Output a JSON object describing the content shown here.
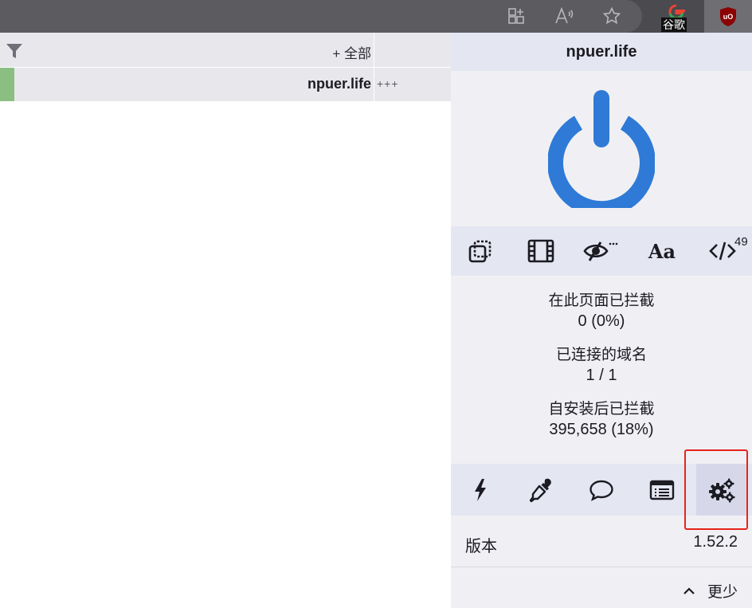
{
  "browser": {
    "google_badge": "谷歌",
    "ublock_logo": "uO"
  },
  "filter": {
    "all_label": "+ 全部"
  },
  "site": {
    "hostname": "npuer.life",
    "rule_marks": "+++"
  },
  "popup": {
    "hostname": "npuer.life",
    "power_color": "#2f7ad6",
    "tools": {
      "cosmetic_count": "49",
      "font_label": "Aa"
    },
    "stats": {
      "blocked_page_label": "在此页面已拦截",
      "blocked_page_value": "0 (0%)",
      "domains_label": "已连接的域名",
      "domains_value": "1 / 1",
      "blocked_total_label": "自安装后已拦截",
      "blocked_total_value": "395,658 (18%)"
    },
    "version_label": "版本",
    "version_value": "1.52.2",
    "less_label": "更少"
  }
}
